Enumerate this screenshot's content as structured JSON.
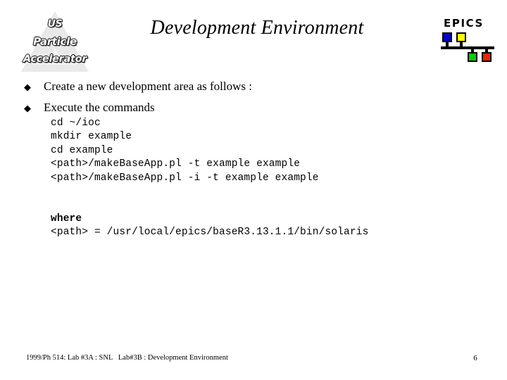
{
  "slide": {
    "title": "Development Environment",
    "page_number": "6",
    "background_color": "#ffffff",
    "text_color": "#000000"
  },
  "uspas_logo": {
    "name": "US Particle Accelerator School logo",
    "line1": "US",
    "line2": "Particle",
    "line3": "Accelerator",
    "triangle_color": "#e8e8e8",
    "text_color": "#ffffff",
    "outline_color": "#000000"
  },
  "epics_logo": {
    "wordmark": "EPICS",
    "nodes": [
      {
        "name": "node-blue",
        "color": "#0000cc",
        "position": "top-left"
      },
      {
        "name": "node-yellow",
        "color": "#ffff00",
        "position": "top-right"
      },
      {
        "name": "node-green",
        "color": "#00cc00",
        "position": "bottom-left"
      },
      {
        "name": "node-red",
        "color": "#ee2200",
        "position": "bottom-right"
      }
    ],
    "bus_color": "#000000"
  },
  "bullets": [
    {
      "marker": "◆",
      "text": "Create a new development area as follows :"
    },
    {
      "marker": "◆",
      "text": "Execute the commands"
    }
  ],
  "code": {
    "lines": [
      "cd ~/ioc",
      "mkdir example",
      "cd example",
      "<path>/makeBaseApp.pl -t example example",
      "<path>/makeBaseApp.pl -i -t example example"
    ],
    "where_label": "where",
    "where_line": "<path> = /usr/local/epics/baseR3.13.1.1/bin/solaris"
  },
  "footer": {
    "left": "1999/Ph 514: Lab #3A : SNL   Lab#3B : Development Environment",
    "page": "6"
  }
}
